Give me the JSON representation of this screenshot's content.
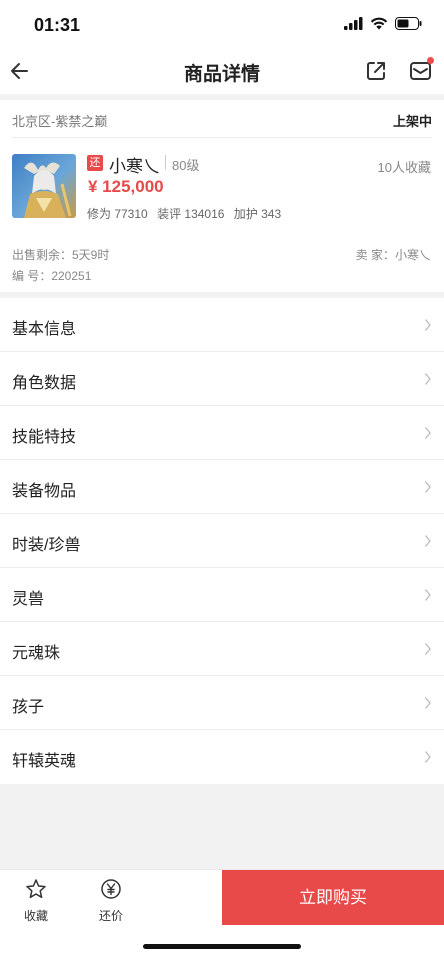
{
  "status_bar": {
    "time": "01:31"
  },
  "nav": {
    "title": "商品详情"
  },
  "item": {
    "server": "北京区-紫禁之巅",
    "listing_status": "上架中",
    "tag": "还",
    "name": "小寒乀",
    "level": "80级",
    "favorites": "10人收藏",
    "price": "¥ 125,000",
    "stats": {
      "xiuwei": "修为 77310",
      "zhuangping": "装评 134016",
      "jiahu": "加护 343"
    },
    "time_remaining": "出售剩余：5天9时",
    "seller": "卖 家：小寒乀",
    "id": "编 号：220251"
  },
  "menu": [
    {
      "label": "基本信息"
    },
    {
      "label": "角色数据"
    },
    {
      "label": "技能特技"
    },
    {
      "label": "装备物品"
    },
    {
      "label": "时装/珍兽"
    },
    {
      "label": "灵兽"
    },
    {
      "label": "元魂珠"
    },
    {
      "label": "孩子"
    },
    {
      "label": "轩辕英魂"
    }
  ],
  "bottom": {
    "favorite_label": "收藏",
    "bargain_label": "还价",
    "buy_label": "立即购买"
  },
  "colors": {
    "accent": "#e84a4a",
    "background": "#f2f2f2"
  },
  "icons": [
    "back-arrow-icon",
    "share-icon",
    "message-icon",
    "chevron-right-icon",
    "star-icon",
    "yen-icon"
  ]
}
